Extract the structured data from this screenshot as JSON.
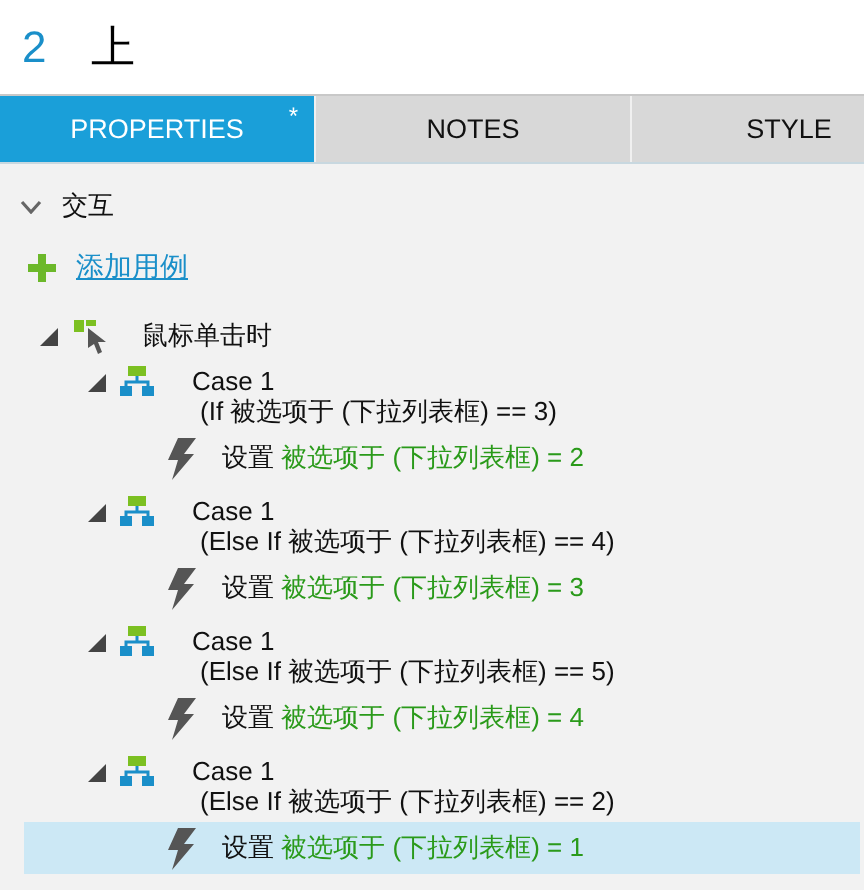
{
  "header": {
    "number": "2",
    "title": "上"
  },
  "tabs": [
    {
      "label": "PROPERTIES",
      "selected": true,
      "modified_mark": "*"
    },
    {
      "label": "NOTES",
      "selected": false
    },
    {
      "label": "STYLE",
      "selected": false
    }
  ],
  "section": {
    "title": "交互",
    "expanded": true
  },
  "add_case": {
    "label": "添加用例"
  },
  "tree": [
    {
      "label": "鼠标单击时",
      "expanded": true,
      "children": [
        {
          "label": "Case 1",
          "condition": "(If 被选项于 (下拉列表框) == 3)",
          "expanded": true,
          "children": [
            {
              "verb": "设置",
              "target": "被选项于 (下拉列表框) = 2",
              "selected": false
            }
          ]
        },
        {
          "label": "Case 1",
          "condition": "(Else If 被选项于 (下拉列表框) == 4)",
          "expanded": true,
          "children": [
            {
              "verb": "设置",
              "target": "被选项于 (下拉列表框) = 3",
              "selected": false
            }
          ]
        },
        {
          "label": "Case 1",
          "condition": "(Else If 被选项于 (下拉列表框) == 5)",
          "expanded": true,
          "children": [
            {
              "verb": "设置",
              "target": "被选项于 (下拉列表框) = 4",
              "selected": false
            }
          ]
        },
        {
          "label": "Case 1",
          "condition": "(Else If 被选项于 (下拉列表框) == 2)",
          "expanded": true,
          "children": [
            {
              "verb": "设置",
              "target": "被选项于 (下拉列表框) = 1",
              "selected": true
            }
          ]
        }
      ]
    }
  ]
}
